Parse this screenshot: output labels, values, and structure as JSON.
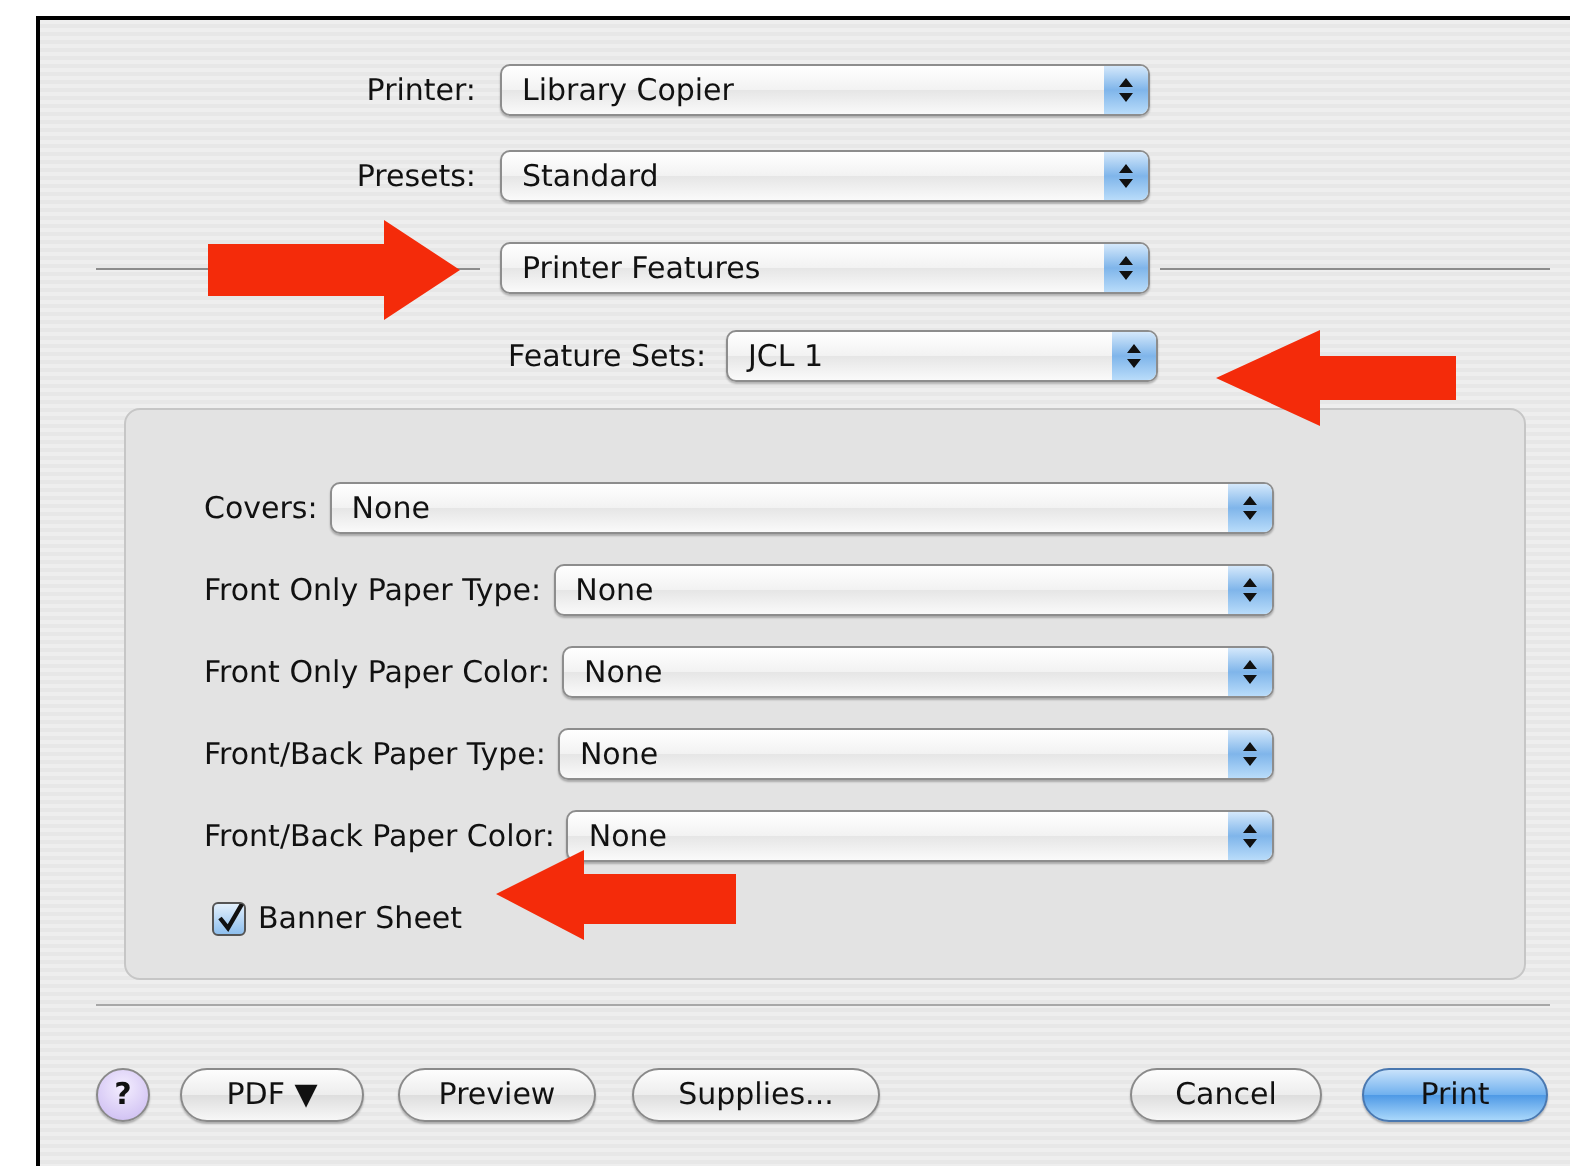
{
  "print_dialog": {
    "top_fields": [
      {
        "label": "Printer:",
        "value": "Library Copier"
      },
      {
        "label": "Presets:",
        "value": "Standard"
      }
    ],
    "section_popup": {
      "value": "Printer Features"
    },
    "feature_sets": {
      "label": "Feature Sets:",
      "value": "JCL 1"
    },
    "options": [
      {
        "kind": "popup",
        "label": "Covers:",
        "value": "None"
      },
      {
        "kind": "popup",
        "label": "Front Only Paper Type:",
        "value": "None"
      },
      {
        "kind": "popup",
        "label": "Front Only Paper Color:",
        "value": "None"
      },
      {
        "kind": "popup",
        "label": "Front/Back Paper Type:",
        "value": "None"
      },
      {
        "kind": "popup",
        "label": "Front/Back Paper Color:",
        "value": "None"
      },
      {
        "kind": "checkbox",
        "label": "Banner Sheet",
        "checked": true
      }
    ],
    "buttons": [
      {
        "kind": "help",
        "label": "?"
      },
      {
        "kind": "menu",
        "label": "PDF ▼"
      },
      {
        "kind": "push",
        "label": "Preview"
      },
      {
        "kind": "push",
        "label": "Supplies..."
      },
      {
        "kind": "push",
        "label": "Cancel"
      },
      {
        "kind": "default",
        "label": "Print"
      }
    ]
  }
}
